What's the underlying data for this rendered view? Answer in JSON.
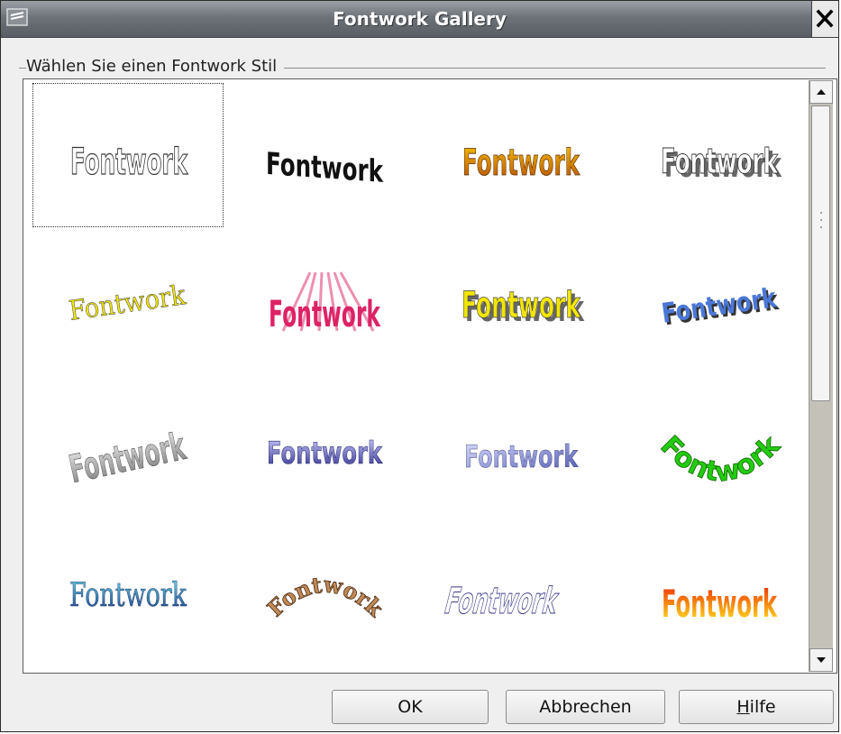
{
  "window": {
    "title": "Fontwork Gallery",
    "close_label": "✕"
  },
  "group": {
    "label": "Wählen Sie einen Fontwork Stil"
  },
  "gallery": {
    "selected_index": 0,
    "items": [
      {
        "text": "Fontwork"
      },
      {
        "text": "Fontwork"
      },
      {
        "text": "Fontwork"
      },
      {
        "text": "Fontwork"
      },
      {
        "text": "Fontwork"
      },
      {
        "text": "Fontwork"
      },
      {
        "text": "Fontwork"
      },
      {
        "text": "Fontwork"
      },
      {
        "text": "Fontwork"
      },
      {
        "text": "Fontwork"
      },
      {
        "text": "Fontwork"
      },
      {
        "text": "Fontwork"
      },
      {
        "text": "Fontwork"
      },
      {
        "text": "Fontwork"
      },
      {
        "text": "Fontwork"
      },
      {
        "text": "Fontwork"
      }
    ]
  },
  "buttons": {
    "ok": "OK",
    "cancel": "Abbrechen",
    "help_accel": "H",
    "help_rest": "ilfe"
  },
  "colors": {
    "titlebar": "#6c7277",
    "style_orange": "#e08a00",
    "style_yellow": "#f2e600",
    "style_blue": "#4a78d8",
    "style_green": "#22cc11",
    "style_red": "#ee2200",
    "style_pink": "#dd2266"
  }
}
